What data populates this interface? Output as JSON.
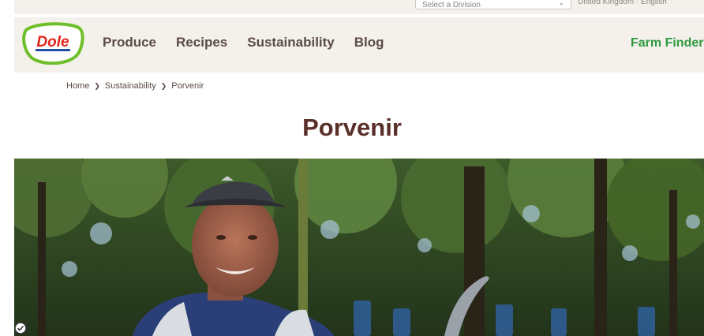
{
  "utility": {
    "country_placeholder": "Select a Division",
    "locale": "United Kingdom · English"
  },
  "header": {
    "logo_text": "Dole",
    "nav": [
      {
        "label": "Produce"
      },
      {
        "label": "Recipes"
      },
      {
        "label": "Sustainability"
      },
      {
        "label": "Blog"
      }
    ],
    "farm_finder": "Farm Finder"
  },
  "breadcrumb": {
    "items": [
      "Home",
      "Sustainability",
      "Porvenir"
    ]
  },
  "page": {
    "title": "Porvenir"
  },
  "hero": {
    "icon": "check-circle-icon"
  },
  "colors": {
    "header_bg": "#f4f0eb",
    "nav_text": "#5a4a44",
    "title": "#5a2f2a",
    "farm_finder": "#2e9a3e",
    "logo_red": "#e2231a",
    "logo_green": "#6fbf2a"
  }
}
